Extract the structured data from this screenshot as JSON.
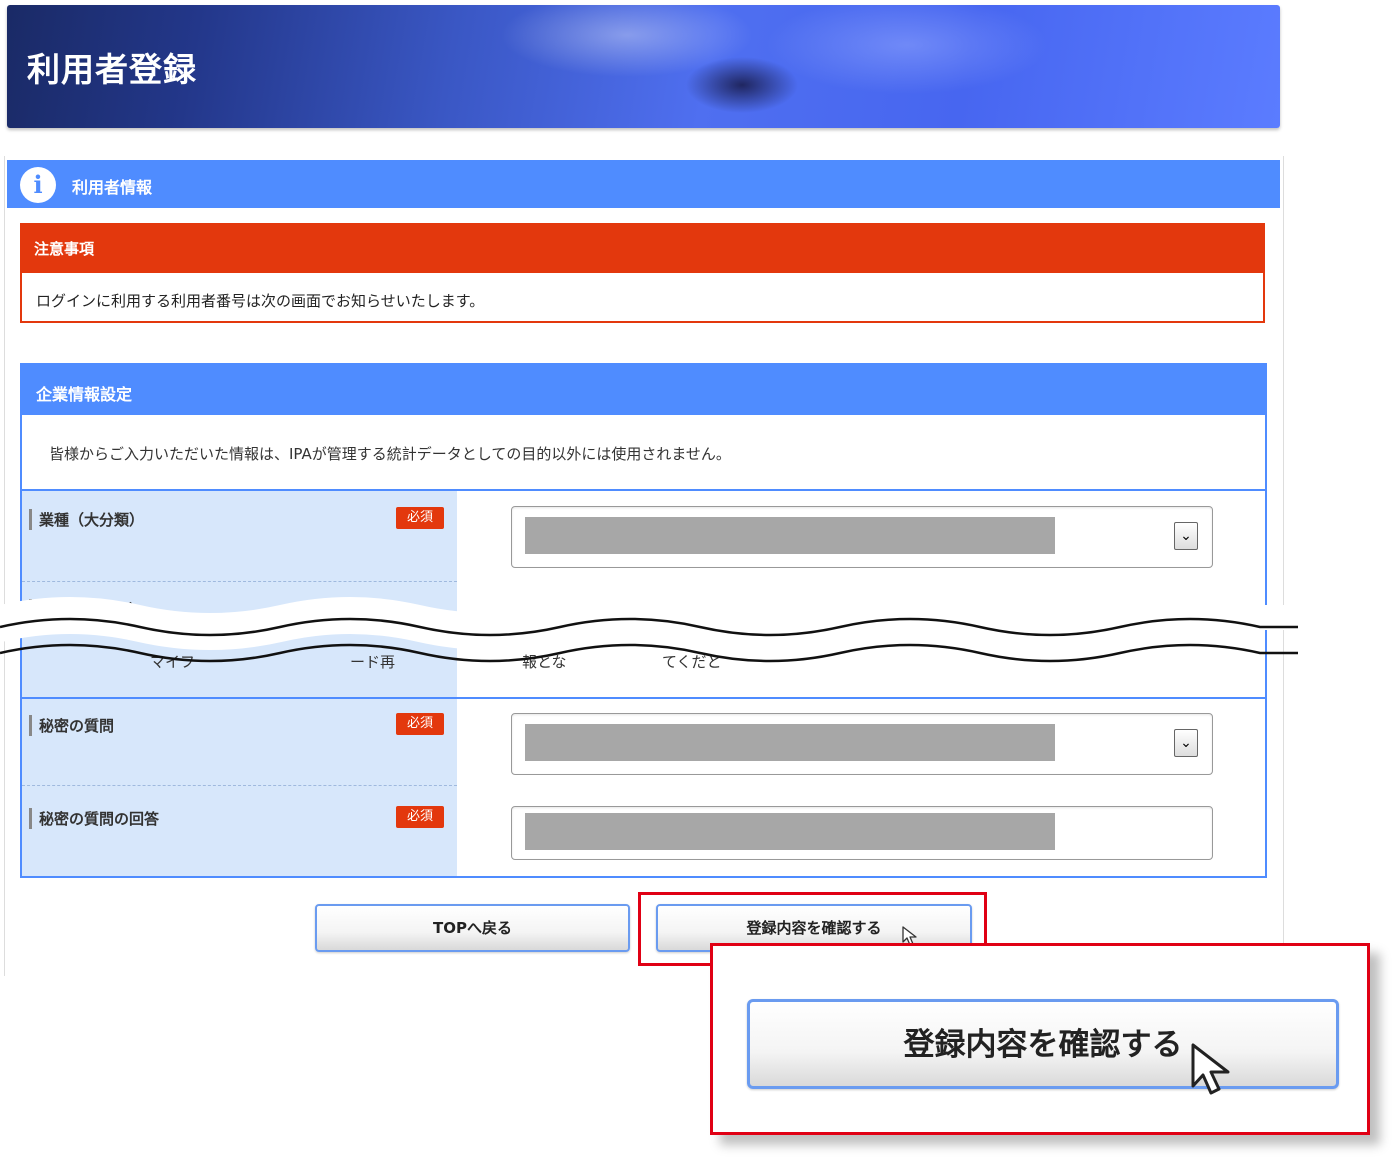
{
  "page": {
    "title": "利用者登録"
  },
  "panel": {
    "title": "利用者情報",
    "info_icon": "info-icon"
  },
  "notice": {
    "title": "注意事項",
    "text": "ログインに利用する利用者番号は次の画面でお知らせいたします。"
  },
  "company_section": {
    "title": "企業情報設定",
    "description": "皆様からご入力いただいた情報は、IPAが管理する統計データとしての目的以外には使用されません。",
    "fields": [
      {
        "label": "業種（大分類）",
        "required_badge": "必須",
        "control": "select"
      },
      {
        "label": "業種（中分類）",
        "partial": true
      },
      {
        "label": "秘密の質問",
        "required_badge": "必須",
        "control": "select"
      },
      {
        "label": "秘密の質問の回答",
        "required_badge": "必須",
        "control": "text"
      }
    ],
    "obscured_text_fragments": [
      "マイフ",
      "ード再",
      "報とな",
      "てくだと"
    ]
  },
  "buttons": {
    "back_label": "TOPへ戻る",
    "confirm_label": "登録内容を確認する"
  },
  "zoom_callout": {
    "button_label": "登録内容を確認する",
    "cursor_icon": "arrow-cursor-icon"
  },
  "colors": {
    "accent_blue": "#4f8cff",
    "alert_red": "#e3380d",
    "highlight_red": "#e00014",
    "label_bg": "#d7e7fb",
    "masked_value": "#a7a7a7"
  }
}
